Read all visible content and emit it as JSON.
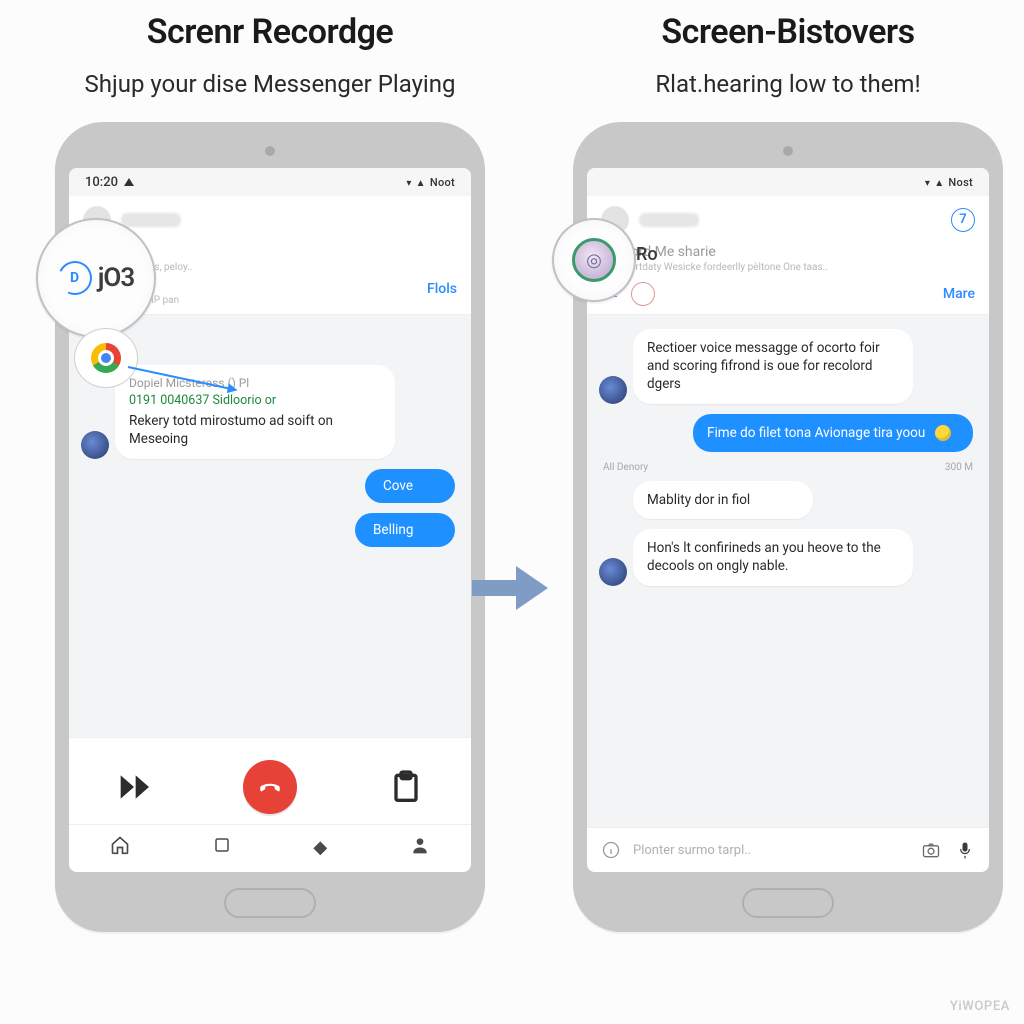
{
  "left": {
    "title": "Screnr Recordge",
    "subtitle": "Shjup your dise Messenger Playing",
    "statusbar": {
      "time": "10:20",
      "carrier": "Noot"
    },
    "header": {
      "title_blur": "tage",
      "sub": "Notonthu Weldes, peloy..",
      "action_link": "Flols",
      "hint": "Deo IP pan"
    },
    "messages": {
      "m1_title": "Dopiel Micsteress () Pl",
      "m1_green": "0191 0040637 Sidloorio or",
      "m1_body": "Rekery totd mirostumo ad soift on Meseoing",
      "out1": "Cove",
      "out2": "Belling"
    },
    "magnifier": {
      "badge": "D",
      "text": "jO3"
    }
  },
  "right": {
    "title": "Screen-Bistovers",
    "subtitle": "Rlat.hearing low to them!",
    "statusbar": {
      "carrier": "Nost"
    },
    "header": {
      "title": "Scoord Me sharie",
      "sub": "Desportdaty Wesicke fordeerlly pèltone One taas..",
      "action_badge": "7",
      "action_link": "Mare"
    },
    "messages": {
      "in1": "Rectioer voice messagge of ocorto foir and scoring fifrond is oue for recolord dgers",
      "out1": "Fime do filet tona Avionage tira yoou",
      "meta_center": "All Denory",
      "meta_right": "300 M",
      "in2": "Mablity dor in fiol",
      "in3": "Hon's lt confirineds an you heove to the decools on ongly nable."
    },
    "input_placeholder": "Plonter surmo tarpl..",
    "magnifier_label": "Ro"
  },
  "watermark": "YiWOPEA"
}
